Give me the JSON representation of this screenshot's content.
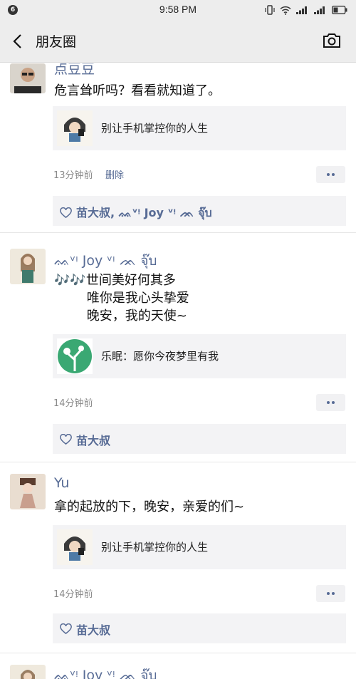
{
  "status_bar": {
    "notification_count": "6",
    "time": "9:58 PM",
    "icons": [
      "vibrate-icon",
      "wifi-icon",
      "signal-icon",
      "signal-icon",
      "battery-icon"
    ]
  },
  "nav": {
    "title": "朋友圈",
    "back_icon": "chevron-left-icon",
    "camera_icon": "camera-icon"
  },
  "colors": {
    "name_link": "#576b95",
    "bar_bg": "#ededed",
    "card_bg": "#f3f3f5"
  },
  "posts": [
    {
      "author": "点豆豆",
      "text": "危言耸听吗？看看就知道了。",
      "link": {
        "title": "别让手机掌控你的人生"
      },
      "time": "13分钟前",
      "delete_label": "删除",
      "likes": "苗大叔, ᨐᵛᵎ Joy ᵛᵎ ᨏ จุ๊บ"
    },
    {
      "author": "ᨐᵛᵎ Joy ᵛᵎ ᨏ จุ๊บ",
      "text": "🎶🎶世间美好何其多\n        唯你是我心头挚爱\n        晚安，我的天使~",
      "link": {
        "title": "乐眠：愿你今夜梦里有我"
      },
      "time": "14分钟前",
      "likes": "苗大叔"
    },
    {
      "author": "Yu",
      "text": "拿的起放的下，晚安，亲爱的们~",
      "link": {
        "title": "别让手机掌控你的人生"
      },
      "time": "14分钟前",
      "likes": "苗大叔"
    },
    {
      "author": "ᨐᵛᵎ Joy ᵛᵎ ᨏ จุ๊บ"
    }
  ]
}
